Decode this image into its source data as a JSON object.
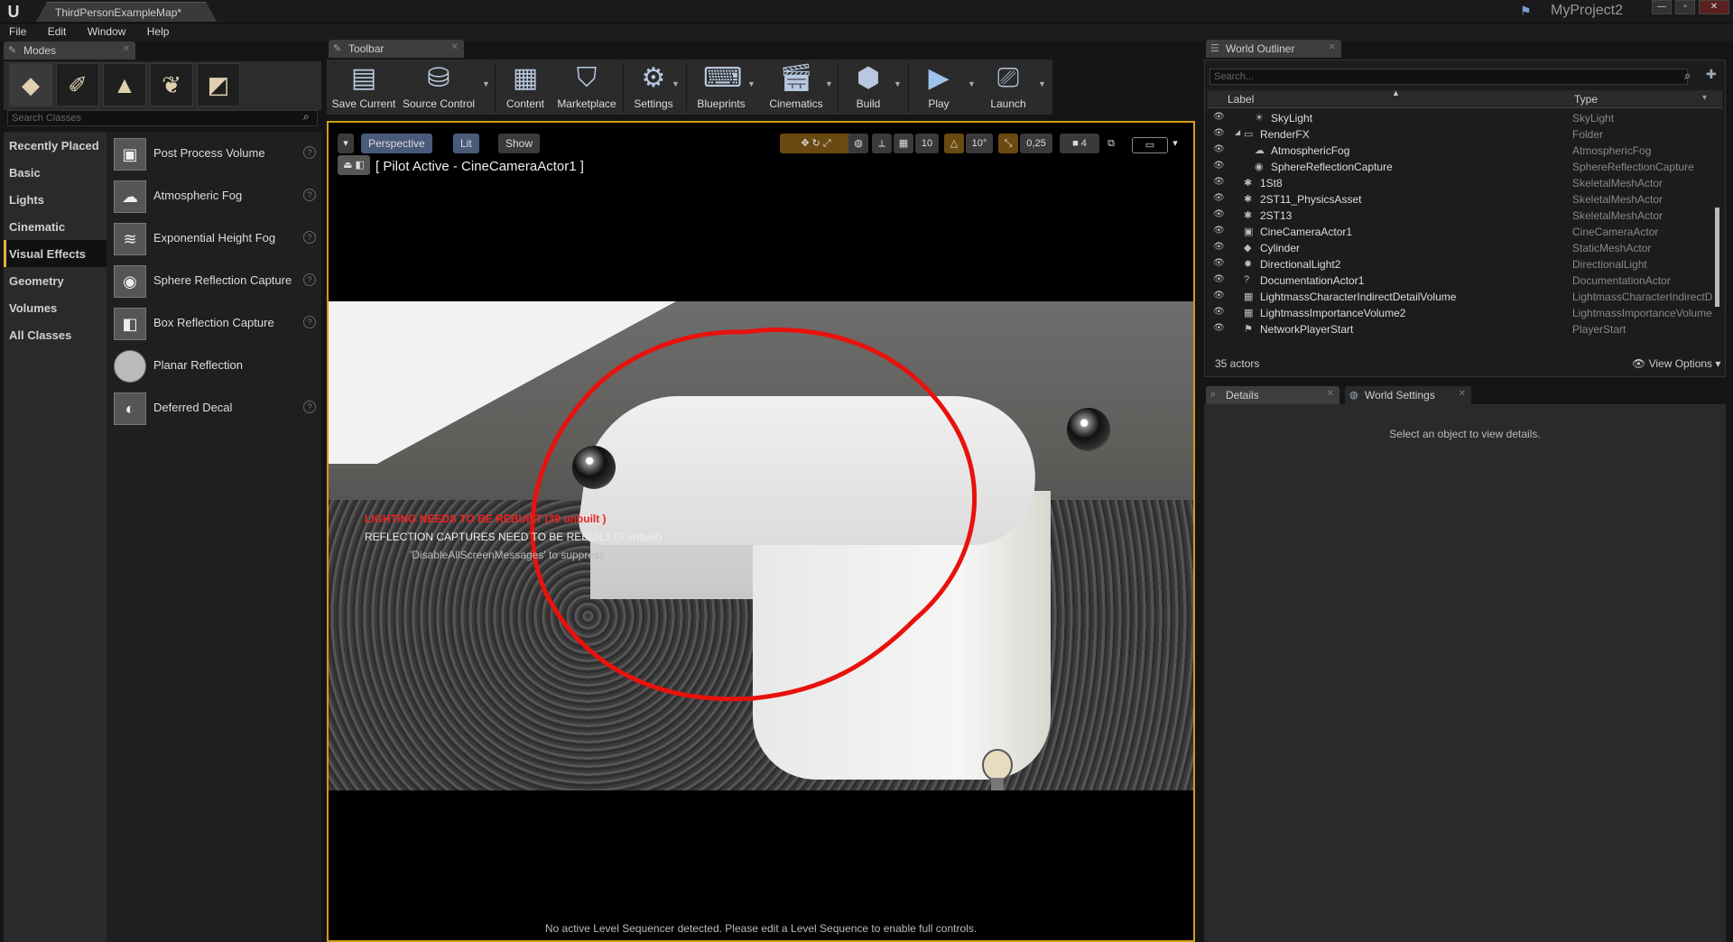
{
  "window": {
    "doc_tab": "ThirdPersonExampleMap*",
    "project": "MyProject2",
    "logo": "U"
  },
  "menu": [
    "File",
    "Edit",
    "Window",
    "Help"
  ],
  "modes": {
    "tab": "Modes",
    "search_placeholder": "Search Classes",
    "categories": [
      "Recently Placed",
      "Basic",
      "Lights",
      "Cinematic",
      "Visual Effects",
      "Geometry",
      "Volumes",
      "All Classes"
    ],
    "selected_category": "Visual Effects",
    "items": [
      {
        "label": "Post Process Volume",
        "icon": "post-process-volume-icon",
        "help": true
      },
      {
        "label": "Atmospheric Fog",
        "icon": "atmospheric-fog-icon",
        "help": true
      },
      {
        "label": "Exponential Height Fog",
        "icon": "exponential-height-fog-icon",
        "help": true
      },
      {
        "label": "Sphere Reflection Capture",
        "icon": "sphere-reflection-capture-icon",
        "help": true
      },
      {
        "label": "Box Reflection Capture",
        "icon": "box-reflection-capture-icon",
        "help": true
      },
      {
        "label": "Planar Reflection",
        "icon": "planar-reflection-icon",
        "help": false
      },
      {
        "label": "Deferred Decal",
        "icon": "deferred-decal-icon",
        "help": true
      }
    ]
  },
  "toolbar": {
    "tab": "Toolbar",
    "buttons": [
      {
        "label": "Save Current",
        "icon": "save-icon"
      },
      {
        "label": "Source Control",
        "icon": "source-control-icon"
      },
      {
        "label": "Content",
        "icon": "content-icon"
      },
      {
        "label": "Marketplace",
        "icon": "marketplace-icon"
      },
      {
        "label": "Settings",
        "icon": "settings-icon"
      },
      {
        "label": "Blueprints",
        "icon": "blueprints-icon"
      },
      {
        "label": "Cinematics",
        "icon": "cinematics-icon"
      },
      {
        "label": "Build",
        "icon": "build-icon"
      },
      {
        "label": "Play",
        "icon": "play-icon"
      },
      {
        "label": "Launch",
        "icon": "launch-icon"
      }
    ]
  },
  "viewport": {
    "perspective": "Perspective",
    "lit": "Lit",
    "show": "Show",
    "grid_snap": "10",
    "rot_snap": "10°",
    "scale_snap": "0,25",
    "cam_speed": "4",
    "pilot": "[ Pilot Active - CineCameraActor1 ]",
    "warn_lighting": "LIGHTING NEEDS TO BE REBUILT (39 unbuilt )",
    "warn_reflection": "REFLECTION CAPTURES NEED TO BE REBUILT (3 unbuilt)",
    "warn_suppress": "'DisableAllScreenMessages' to suppress",
    "no_sequencer": "No active Level Sequencer detected. Please edit a Level Sequence to enable full controls."
  },
  "outliner": {
    "tab": "World Outliner",
    "search_placeholder": "Search...",
    "col_label": "Label",
    "col_type": "Type",
    "rows": [
      {
        "label": "SkyLight",
        "type": "SkyLight",
        "indent": 2
      },
      {
        "label": "RenderFX",
        "type": "Folder",
        "indent": 1
      },
      {
        "label": "AtmosphericFog",
        "type": "AtmosphericFog",
        "indent": 2
      },
      {
        "label": "SphereReflectionCapture",
        "type": "SphereReflectionCapture",
        "indent": 2
      },
      {
        "label": "1St8",
        "type": "SkeletalMeshActor",
        "indent": 1
      },
      {
        "label": "2ST11_PhysicsAsset",
        "type": "SkeletalMeshActor",
        "indent": 1
      },
      {
        "label": "2ST13",
        "type": "SkeletalMeshActor",
        "indent": 1
      },
      {
        "label": "CineCameraActor1",
        "type": "CineCameraActor",
        "indent": 1
      },
      {
        "label": "Cylinder",
        "type": "StaticMeshActor",
        "indent": 1
      },
      {
        "label": "DirectionalLight2",
        "type": "DirectionalLight",
        "indent": 1
      },
      {
        "label": "DocumentationActor1",
        "type": "DocumentationActor",
        "indent": 1
      },
      {
        "label": "LightmassCharacterIndirectDetailVolume",
        "type": "LightmassCharacterIndirectD",
        "indent": 1
      },
      {
        "label": "LightmassImportanceVolume2",
        "type": "LightmassImportanceVolume",
        "indent": 1
      },
      {
        "label": "NetworkPlayerStart",
        "type": "PlayerStart",
        "indent": 1
      }
    ],
    "count": "35 actors",
    "view_options": "View Options"
  },
  "details": {
    "tab": "Details",
    "world_settings_tab": "World Settings",
    "message": "Select an object to view details."
  }
}
